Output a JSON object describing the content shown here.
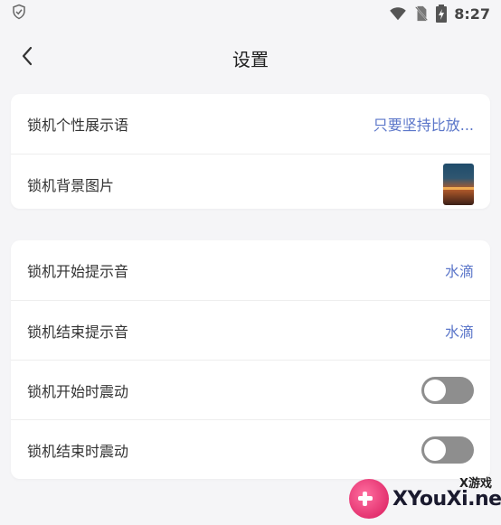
{
  "status_bar": {
    "time": "8:27",
    "icons": [
      "shield-check-icon",
      "wifi-icon",
      "no-sim-icon",
      "battery-icon"
    ]
  },
  "header": {
    "title": "设置"
  },
  "section1": {
    "items": [
      {
        "label": "锁机个性展示语",
        "value": "只要坚持比放..."
      },
      {
        "label": "锁机背景图片"
      }
    ]
  },
  "section2": {
    "items": [
      {
        "label": "锁机开始提示音",
        "value": "水滴"
      },
      {
        "label": "锁机结束提示音",
        "value": "水滴"
      },
      {
        "label": "锁机开始时震动",
        "toggle_on": false
      },
      {
        "label": "锁机结束时震动",
        "toggle_on": false
      }
    ]
  },
  "watermark": {
    "small": "X游戏",
    "text": "XYouXi.net"
  },
  "colors": {
    "accent": "#5b76c9",
    "toggle_off": "#8e8e8e",
    "background": "#f5f5f7"
  }
}
